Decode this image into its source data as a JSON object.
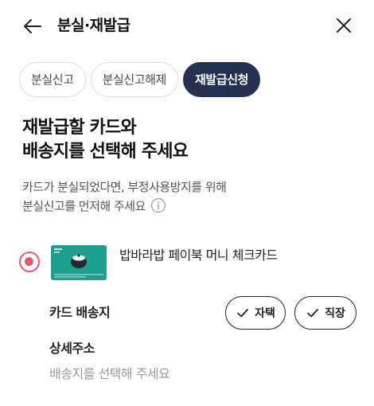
{
  "header": {
    "back_icon": "arrow-left-icon",
    "title": "분실·재발급",
    "close_icon": "close-icon"
  },
  "tabs": [
    {
      "label": "분실신고",
      "active": false
    },
    {
      "label": "분실신고해제",
      "active": false
    },
    {
      "label": "재발급신청",
      "active": true
    }
  ],
  "main": {
    "heading_line1": "재발급할 카드와",
    "heading_line2": "배송지를 선택해 주세요",
    "notice_line1": "카드가 분실되었다면, 부정사용방지를 위해",
    "notice_line2": "분실신고를 먼저해 주세요",
    "info_icon": "info-icon"
  },
  "card": {
    "selected": true,
    "name": "밥바라밥 페이북 머니 체크카드",
    "color": "#1fa08f"
  },
  "delivery": {
    "label": "카드 배송지",
    "options": [
      {
        "label": "자택",
        "icon": "check-icon"
      },
      {
        "label": "직장",
        "icon": "check-icon"
      }
    ]
  },
  "address": {
    "label": "상세주소",
    "placeholder": "배송지를 선택해 주세요"
  },
  "colors": {
    "accent_navy": "#24324f",
    "radio_red": "#e35d6a"
  }
}
